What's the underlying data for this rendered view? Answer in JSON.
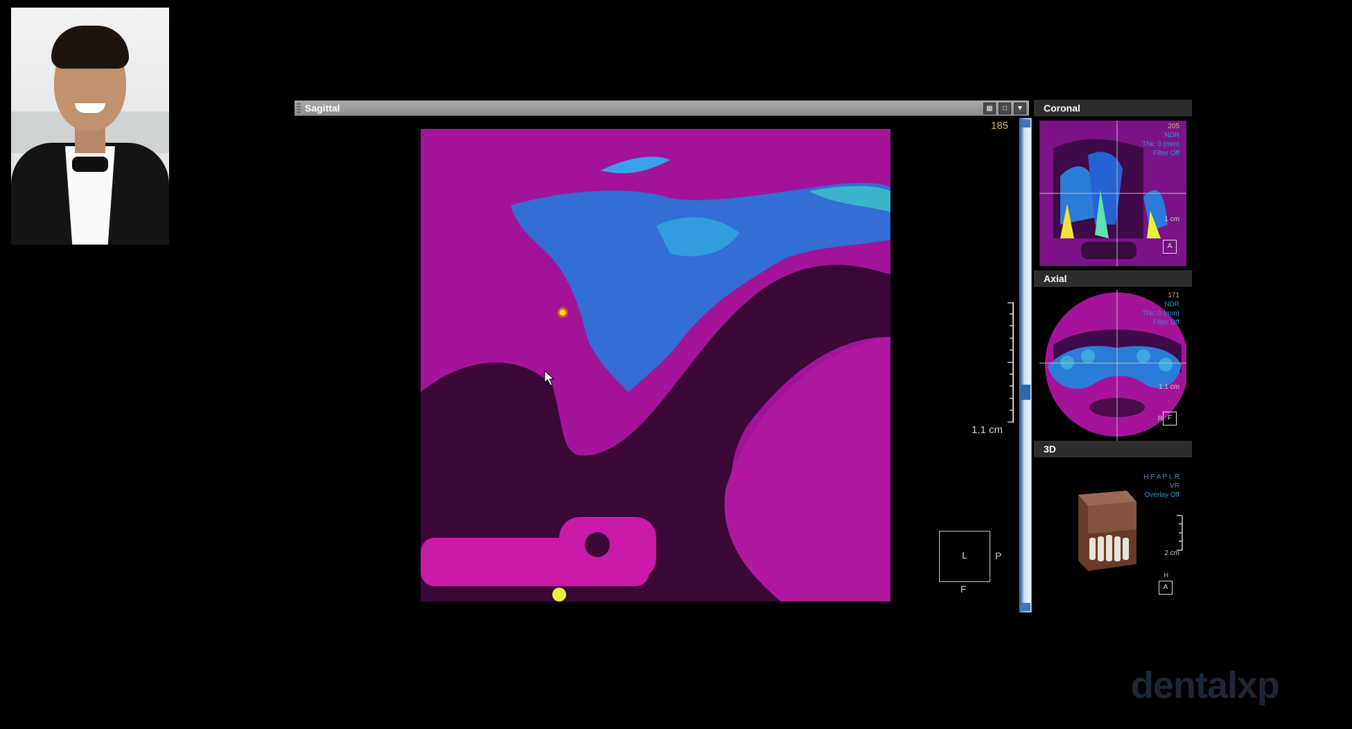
{
  "presenter": {
    "photo_alt": "presenter"
  },
  "sagittal": {
    "title": "Sagittal",
    "slice_number": "185",
    "scale_label": "1.1 cm",
    "orientation": {
      "center": "L",
      "right": "P",
      "bottom": "F"
    },
    "header_buttons": [
      "layout-icon",
      "maximize-icon",
      "chevron-down-icon"
    ]
  },
  "coronal": {
    "title": "Coronal",
    "slice_number": "205",
    "overlay_lines": [
      "NDR",
      "Thk: 0 (mm)",
      "Filter Off"
    ],
    "scale_label": "1 cm",
    "orientation_box": "A"
  },
  "axial": {
    "title": "Axial",
    "slice_number": "171",
    "overlay_lines": [
      "NDR",
      "Thk: 0 (mm)",
      "Filter Off"
    ],
    "scale_label": "1.1 cm",
    "orientation_box": "F",
    "orientation_side": "R"
  },
  "three_d": {
    "title": "3D",
    "overlay_lines": [
      "H F A P L R",
      "VR",
      "Overlay Off"
    ],
    "scale_label": "2 cm",
    "orientation_box": "A",
    "orientation_top": "H"
  },
  "watermark": "dentalxp",
  "colors": {
    "magenta": "#a6139b",
    "bone_blue": "#2e7bd6",
    "slice_number": "#e3b14a",
    "header_grey": "#9a9a9a"
  }
}
